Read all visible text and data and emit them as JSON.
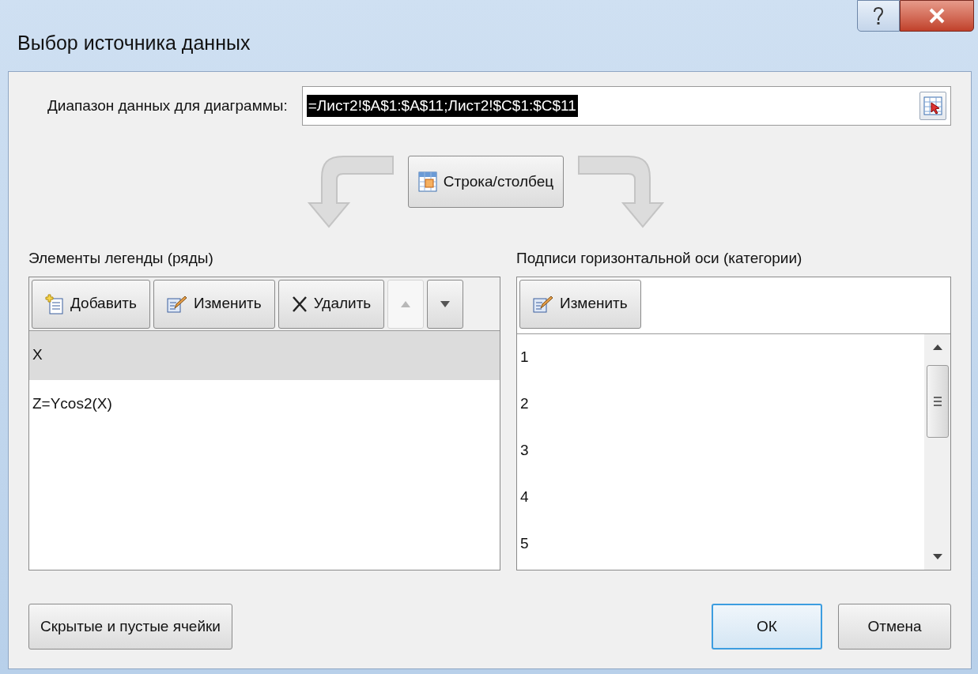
{
  "window": {
    "title": "Выбор источника данных"
  },
  "data_range": {
    "label": "Диапазон данных для диаграммы:",
    "value": "=Лист2!$A$1:$A$11;Лист2!$C$1:$C$11",
    "value_selected": true
  },
  "switch_button": {
    "label": "Строка/столбец"
  },
  "legend": {
    "label": "Элементы легенды (ряды)",
    "buttons": [
      {
        "kind": "add",
        "label": "Добавить"
      },
      {
        "kind": "edit",
        "label": "Изменить"
      },
      {
        "kind": "delete",
        "label": "Удалить"
      }
    ],
    "move_up": {
      "disabled": true
    },
    "move_down": {
      "disabled": false
    },
    "items": [
      {
        "label": "X",
        "selected": true
      },
      {
        "label": "Z=Ycos2(X)",
        "selected": false
      }
    ]
  },
  "categories": {
    "label": "Подписи горизонтальной оси (категории)",
    "button": {
      "kind": "edit",
      "label": "Изменить"
    },
    "items": [
      {
        "label": "1"
      },
      {
        "label": "2"
      },
      {
        "label": "3"
      },
      {
        "label": "4"
      },
      {
        "label": "5"
      }
    ]
  },
  "footer": {
    "hidden_cells_button": "Скрытые и пустые ячейки",
    "ok_button": "ОК",
    "cancel_button": "Отмена"
  }
}
